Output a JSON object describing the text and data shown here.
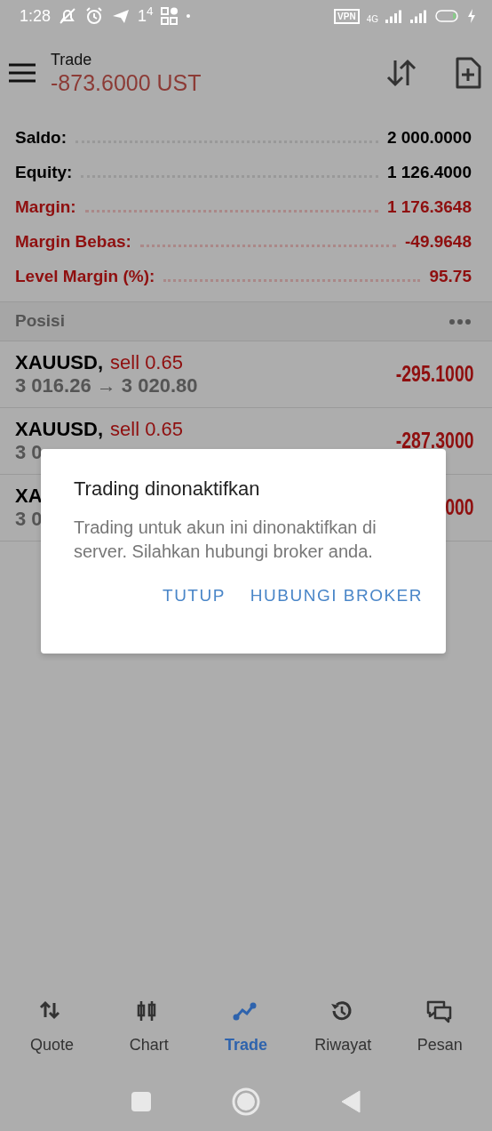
{
  "status_bar": {
    "time": "1:28",
    "notification_count": "1$^{4}$",
    "vpn": "VPN",
    "network": "4G"
  },
  "header": {
    "title": "Trade",
    "balance": "-873.6000 UST"
  },
  "summary": [
    {
      "label": "Saldo:",
      "value": "2 000.0000",
      "alert": false
    },
    {
      "label": "Equity:",
      "value": "1 126.4000",
      "alert": false
    },
    {
      "label": "Margin:",
      "value": "1 176.3648",
      "alert": true
    },
    {
      "label": "Margin Bebas:",
      "value": "-49.9648",
      "alert": true
    },
    {
      "label": "Level Margin (%):",
      "value": "95.75",
      "alert": true
    }
  ],
  "positions": {
    "title": "Posisi",
    "items": [
      {
        "symbol": "XAUUSD,",
        "side": "sell 0.65",
        "prices": "3 016.26 → 3 020.80",
        "profit": "-295.1000"
      },
      {
        "symbol": "XAUUSD,",
        "side": "sell 0.65",
        "prices": "3 0",
        "profit": "-287.3000"
      },
      {
        "symbol": "XA",
        "prices": "3 0",
        "profit": "000"
      }
    ]
  },
  "dialog": {
    "title": "Trading dinonaktifkan",
    "message": "Trading untuk akun ini dinonaktifkan di server. Silahkan hubungi broker anda.",
    "buttons": [
      "TUTUP",
      "HUBUNGI BROKER"
    ]
  },
  "bottom_nav": [
    {
      "label": "Quote",
      "kind": "quote",
      "selected": false
    },
    {
      "label": "Chart",
      "kind": "chart",
      "selected": false
    },
    {
      "label": "Trade",
      "kind": "trade",
      "selected": true
    },
    {
      "label": "Riwayat",
      "kind": "history",
      "selected": false
    },
    {
      "label": "Pesan",
      "kind": "chat",
      "selected": false
    }
  ]
}
